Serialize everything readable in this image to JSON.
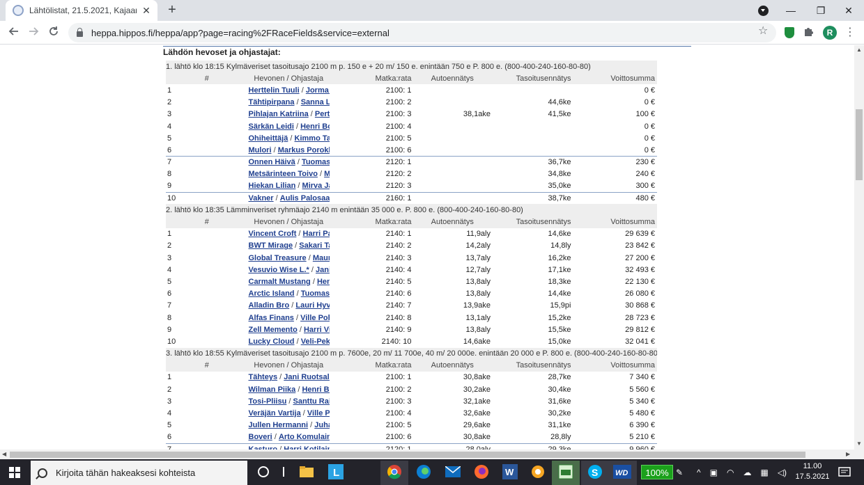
{
  "browser": {
    "tab_title": "Lähtölistat, 21.5.2021, Kajaani - H",
    "new_tab": "+",
    "url": "heppa.hippos.fi/heppa/app?page=racing%2FRaceFields&service=external",
    "profile_initial": "R",
    "minimize": "—",
    "restore": "❐",
    "close": "✕"
  },
  "page": {
    "section_title": "Lähdön hevoset ja ohjastajat:",
    "columns": {
      "num": "#",
      "horse": "Hevonen / Ohjastaja",
      "dist": "Matka:rata",
      "auto": "Autoennätys",
      "tas": "Tasoitusennätys",
      "win": "Voittosumma"
    },
    "separator": "/",
    "races": [
      {
        "header": "1. lähtö klo 18:15 Kylmäveriset tasoitusajo 2100 m p. 150 e + 20 m/ 150 e. enintään 750 e P. 800 e. (800-400-240-160-80-80)",
        "rows": [
          {
            "num": "1",
            "horse": "Herttelin Tuuli",
            "driver": "Jorma Tiilikainen",
            "dist": "2100: 1",
            "auto": "",
            "tas": "",
            "win": "0 €"
          },
          {
            "num": "2",
            "horse": "Tähtipirpana",
            "driver": "Sanna Lehto",
            "dist": "2100: 2",
            "auto": "",
            "tas": "44,6ke",
            "win": "0 €"
          },
          {
            "num": "3",
            "horse": "Pihlajan Katriina",
            "driver": "Pertti Taskinen",
            "dist": "2100: 3",
            "auto": "38,1ake",
            "tas": "41,5ke",
            "win": "100 €"
          },
          {
            "num": "4",
            "horse": "Särkän Leidi",
            "driver": "Henri Bollström",
            "dist": "2100: 4",
            "auto": "",
            "tas": "",
            "win": "0 €"
          },
          {
            "num": "5",
            "horse": "Ohiheittäjä",
            "driver": "Kimmo Taipale",
            "dist": "2100: 5",
            "auto": "",
            "tas": "",
            "win": "0 €"
          },
          {
            "num": "6",
            "horse": "Mulori",
            "driver": "Markus Porokka",
            "dist": "2100: 6",
            "auto": "",
            "tas": "",
            "win": "0 €"
          },
          {
            "num": "7",
            "horse": "Onnen Häivä",
            "driver": "Tuomas Pakkanen",
            "dist": "2120: 1",
            "auto": "",
            "tas": "36,7ke",
            "win": "230 €",
            "divider": true
          },
          {
            "num": "8",
            "horse": "Metsärinteen Toivo",
            "driver": "Mauri Jaara",
            "dist": "2120: 2",
            "auto": "",
            "tas": "34,8ke",
            "win": "240 €"
          },
          {
            "num": "9",
            "horse": "Hiekan Lilian",
            "driver": "Mirva Janatuinen",
            "dist": "2120: 3",
            "auto": "",
            "tas": "35,0ke",
            "win": "300 €"
          },
          {
            "num": "10",
            "horse": "Vakner",
            "driver": "Aulis Palosaari",
            "dist": "2160: 1",
            "auto": "",
            "tas": "38,7ke",
            "win": "480 €",
            "divider": true
          }
        ]
      },
      {
        "header": "2. lähtö klo 18:35 Lämminveriset ryhmäajo 2140 m enintään 35 000 e. P. 800 e. (800-400-240-160-80-80)",
        "rows": [
          {
            "num": "1",
            "horse": "Vincent Croft",
            "driver": "Harri Partanen",
            "dist": "2140: 1",
            "auto": "11,9aly",
            "tas": "14,6ke",
            "win": "29 639 €"
          },
          {
            "num": "2",
            "horse": "BWT Mirage",
            "driver": "Sakari Talikka",
            "dist": "2140: 2",
            "auto": "14,2aly",
            "tas": "14,8ly",
            "win": "23 842 €"
          },
          {
            "num": "3",
            "horse": "Global Treasure",
            "driver": "Mauri Jaara",
            "dist": "2140: 3",
            "auto": "13,7aly",
            "tas": "16,2ke",
            "win": "27 200 €"
          },
          {
            "num": "4",
            "horse": "Vesuvio Wise L.*",
            "driver": "Jani Ruotsalainen",
            "dist": "2140: 4",
            "auto": "12,7aly",
            "tas": "17,1ke",
            "win": "32 493 €"
          },
          {
            "num": "5",
            "horse": "Carmalt Mustang",
            "driver": "Henri Bollström",
            "dist": "2140: 5",
            "auto": "13,8aly",
            "tas": "18,3ke",
            "win": "22 130 €"
          },
          {
            "num": "6",
            "horse": "Arctic Island",
            "driver": "Tuomas Pakkanen",
            "dist": "2140: 6",
            "auto": "13,8aly",
            "tas": "14,4ke",
            "win": "26 080 €"
          },
          {
            "num": "7",
            "horse": "Alladin Bro",
            "driver": "Lauri Hyvönen",
            "dist": "2140: 7",
            "auto": "13,9ake",
            "tas": "15,9pi",
            "win": "30 868 €"
          },
          {
            "num": "8",
            "horse": "Alfas Finans",
            "driver": "Ville Pohjola",
            "dist": "2140: 8",
            "auto": "13,1aly",
            "tas": "15,2ke",
            "win": "28 723 €"
          },
          {
            "num": "9",
            "horse": "Zell Memento",
            "driver": "Harri Vimpari",
            "dist": "2140: 9",
            "auto": "13,8aly",
            "tas": "15,5ke",
            "win": "29 812 €"
          },
          {
            "num": "10",
            "horse": "Lucky Cloud",
            "driver": "Veli-Pekka Toivanen",
            "dist": "2140: 10",
            "auto": "14,6ake",
            "tas": "15,0ke",
            "win": "32 041 €"
          }
        ]
      },
      {
        "header": "3. lähtö klo 18:55 Kylmäveriset tasoitusajo 2100 m p. 7600e, 20 m/ 11 700e, 40 m/ 20 000e. enintään 20 000 e P. 800 e. (800-400-240-160-80-80)",
        "rows": [
          {
            "num": "1",
            "horse": "Tähteys",
            "driver": "Jani Ruotsalainen",
            "dist": "2100: 1",
            "auto": "30,8ake",
            "tas": "28,7ke",
            "win": "7 340 €"
          },
          {
            "num": "2",
            "horse": "Wilman Piika",
            "driver": "Henri Bollström",
            "dist": "2100: 2",
            "auto": "30,2ake",
            "tas": "30,4ke",
            "win": "5 560 €"
          },
          {
            "num": "3",
            "horse": "Tosi-Pliisu",
            "driver": "Santtu Raitala",
            "dist": "2100: 3",
            "auto": "32,1ake",
            "tas": "31,6ke",
            "win": "5 340 €"
          },
          {
            "num": "4",
            "horse": "Veräjän Vartija",
            "driver": "Ville Pohjola",
            "dist": "2100: 4",
            "auto": "32,6ake",
            "tas": "30,2ke",
            "win": "5 480 €"
          },
          {
            "num": "5",
            "horse": "Jullen Hermanni",
            "driver": "Juhani Harmoinen",
            "dist": "2100: 5",
            "auto": "29,6ake",
            "tas": "31,1ke",
            "win": "6 390 €"
          },
          {
            "num": "6",
            "horse": "Boveri",
            "driver": "Arto Komulainen",
            "dist": "2100: 6",
            "auto": "30,8ake",
            "tas": "28,8ly",
            "win": "5 210 €"
          },
          {
            "num": "7",
            "horse": "Kasturo",
            "driver": "Harri Kotilainen",
            "dist": "2120: 1",
            "auto": "28,0aly",
            "tas": "29,3ke",
            "win": "9 960 €",
            "divider": true
          }
        ]
      }
    ]
  },
  "taskbar": {
    "search_placeholder": "Kirjoita tähän hakeaksesi kohteista",
    "battery": "100%",
    "time": "11.00",
    "date": "17.5.2021",
    "pinned": [
      "cortana-icon",
      "task-view-icon",
      "file-explorer-icon",
      "l-app-icon",
      "chrome-icon",
      "edge-icon",
      "mail-icon",
      "firefox-icon",
      "word-icon",
      "sun-app-icon",
      "green-app-icon",
      "skype-icon",
      "wd-icon"
    ]
  }
}
